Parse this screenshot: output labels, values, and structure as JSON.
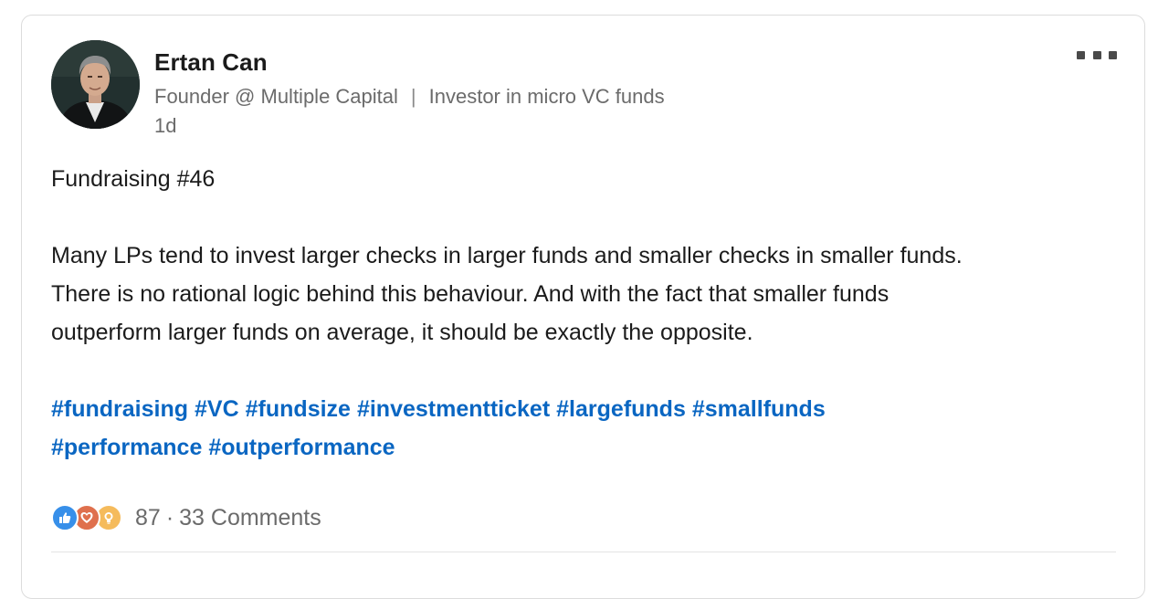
{
  "author": {
    "name": "Ertan Can",
    "headline_role": "Founder @ Multiple Capital",
    "headline_separator": "|",
    "headline_focus": "Investor in micro VC funds",
    "time_ago": "1d"
  },
  "post": {
    "title_line": "Fundraising #46",
    "paragraph_lines": [
      "Many LPs tend to invest larger checks in larger funds and smaller checks in smaller funds.",
      "There is no rational logic behind this behaviour. And with the fact that smaller funds",
      "outperform larger funds on average, it should be exactly the opposite."
    ],
    "hashtags": [
      "#fundraising",
      "#VC",
      "#fundsize",
      "#investmentticket",
      "#largefunds",
      "#smallfunds",
      "#performance",
      "#outperformance"
    ]
  },
  "social": {
    "reaction_icons": [
      "like-icon",
      "love-icon",
      "insightful-icon"
    ],
    "reaction_count": "87",
    "dot": "·",
    "comments_label": "33 Comments"
  },
  "colors": {
    "hashtag": "#0a66c2",
    "like": "#378fe9",
    "love": "#df704d",
    "insightful": "#f5bb5c"
  }
}
